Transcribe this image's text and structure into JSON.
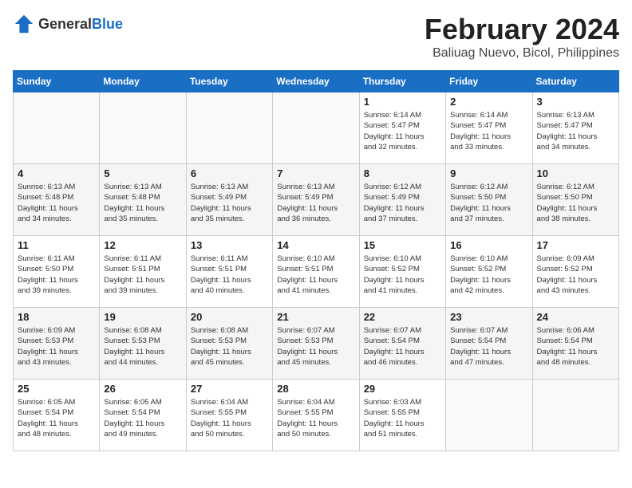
{
  "logo": {
    "text_general": "General",
    "text_blue": "Blue"
  },
  "title": "February 2024",
  "subtitle": "Baliuag Nuevo, Bicol, Philippines",
  "days_of_week": [
    "Sunday",
    "Monday",
    "Tuesday",
    "Wednesday",
    "Thursday",
    "Friday",
    "Saturday"
  ],
  "weeks": [
    [
      {
        "day": "",
        "info": ""
      },
      {
        "day": "",
        "info": ""
      },
      {
        "day": "",
        "info": ""
      },
      {
        "day": "",
        "info": ""
      },
      {
        "day": "1",
        "info": "Sunrise: 6:14 AM\nSunset: 5:47 PM\nDaylight: 11 hours\nand 32 minutes."
      },
      {
        "day": "2",
        "info": "Sunrise: 6:14 AM\nSunset: 5:47 PM\nDaylight: 11 hours\nand 33 minutes."
      },
      {
        "day": "3",
        "info": "Sunrise: 6:13 AM\nSunset: 5:47 PM\nDaylight: 11 hours\nand 34 minutes."
      }
    ],
    [
      {
        "day": "4",
        "info": "Sunrise: 6:13 AM\nSunset: 5:48 PM\nDaylight: 11 hours\nand 34 minutes."
      },
      {
        "day": "5",
        "info": "Sunrise: 6:13 AM\nSunset: 5:48 PM\nDaylight: 11 hours\nand 35 minutes."
      },
      {
        "day": "6",
        "info": "Sunrise: 6:13 AM\nSunset: 5:49 PM\nDaylight: 11 hours\nand 35 minutes."
      },
      {
        "day": "7",
        "info": "Sunrise: 6:13 AM\nSunset: 5:49 PM\nDaylight: 11 hours\nand 36 minutes."
      },
      {
        "day": "8",
        "info": "Sunrise: 6:12 AM\nSunset: 5:49 PM\nDaylight: 11 hours\nand 37 minutes."
      },
      {
        "day": "9",
        "info": "Sunrise: 6:12 AM\nSunset: 5:50 PM\nDaylight: 11 hours\nand 37 minutes."
      },
      {
        "day": "10",
        "info": "Sunrise: 6:12 AM\nSunset: 5:50 PM\nDaylight: 11 hours\nand 38 minutes."
      }
    ],
    [
      {
        "day": "11",
        "info": "Sunrise: 6:11 AM\nSunset: 5:50 PM\nDaylight: 11 hours\nand 39 minutes."
      },
      {
        "day": "12",
        "info": "Sunrise: 6:11 AM\nSunset: 5:51 PM\nDaylight: 11 hours\nand 39 minutes."
      },
      {
        "day": "13",
        "info": "Sunrise: 6:11 AM\nSunset: 5:51 PM\nDaylight: 11 hours\nand 40 minutes."
      },
      {
        "day": "14",
        "info": "Sunrise: 6:10 AM\nSunset: 5:51 PM\nDaylight: 11 hours\nand 41 minutes."
      },
      {
        "day": "15",
        "info": "Sunrise: 6:10 AM\nSunset: 5:52 PM\nDaylight: 11 hours\nand 41 minutes."
      },
      {
        "day": "16",
        "info": "Sunrise: 6:10 AM\nSunset: 5:52 PM\nDaylight: 11 hours\nand 42 minutes."
      },
      {
        "day": "17",
        "info": "Sunrise: 6:09 AM\nSunset: 5:52 PM\nDaylight: 11 hours\nand 43 minutes."
      }
    ],
    [
      {
        "day": "18",
        "info": "Sunrise: 6:09 AM\nSunset: 5:53 PM\nDaylight: 11 hours\nand 43 minutes."
      },
      {
        "day": "19",
        "info": "Sunrise: 6:08 AM\nSunset: 5:53 PM\nDaylight: 11 hours\nand 44 minutes."
      },
      {
        "day": "20",
        "info": "Sunrise: 6:08 AM\nSunset: 5:53 PM\nDaylight: 11 hours\nand 45 minutes."
      },
      {
        "day": "21",
        "info": "Sunrise: 6:07 AM\nSunset: 5:53 PM\nDaylight: 11 hours\nand 45 minutes."
      },
      {
        "day": "22",
        "info": "Sunrise: 6:07 AM\nSunset: 5:54 PM\nDaylight: 11 hours\nand 46 minutes."
      },
      {
        "day": "23",
        "info": "Sunrise: 6:07 AM\nSunset: 5:54 PM\nDaylight: 11 hours\nand 47 minutes."
      },
      {
        "day": "24",
        "info": "Sunrise: 6:06 AM\nSunset: 5:54 PM\nDaylight: 11 hours\nand 48 minutes."
      }
    ],
    [
      {
        "day": "25",
        "info": "Sunrise: 6:05 AM\nSunset: 5:54 PM\nDaylight: 11 hours\nand 48 minutes."
      },
      {
        "day": "26",
        "info": "Sunrise: 6:05 AM\nSunset: 5:54 PM\nDaylight: 11 hours\nand 49 minutes."
      },
      {
        "day": "27",
        "info": "Sunrise: 6:04 AM\nSunset: 5:55 PM\nDaylight: 11 hours\nand 50 minutes."
      },
      {
        "day": "28",
        "info": "Sunrise: 6:04 AM\nSunset: 5:55 PM\nDaylight: 11 hours\nand 50 minutes."
      },
      {
        "day": "29",
        "info": "Sunrise: 6:03 AM\nSunset: 5:55 PM\nDaylight: 11 hours\nand 51 minutes."
      },
      {
        "day": "",
        "info": ""
      },
      {
        "day": "",
        "info": ""
      }
    ]
  ]
}
